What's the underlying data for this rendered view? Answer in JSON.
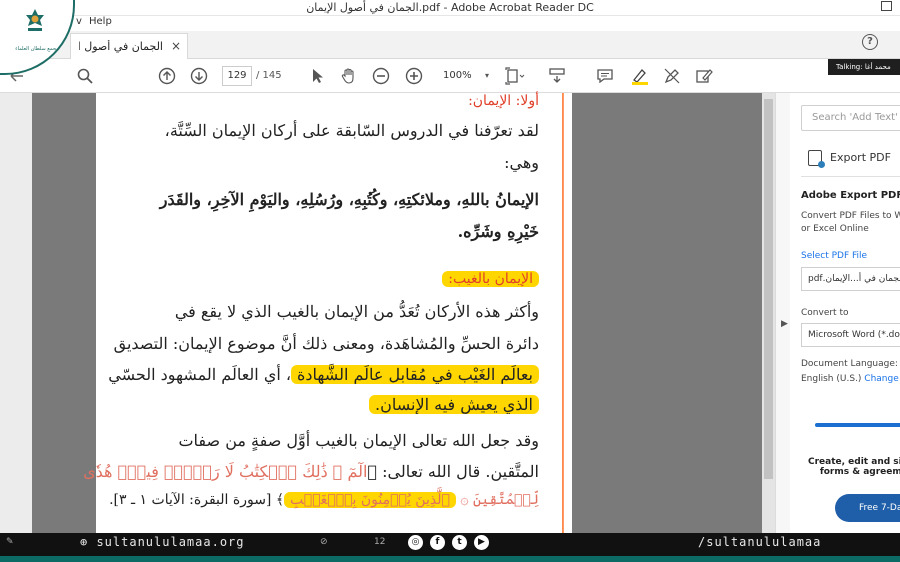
{
  "window": {
    "title": "الجمان في أصول الإيمان.pdf - Adobe Acrobat Reader DC",
    "menu": [
      "v",
      "Help"
    ]
  },
  "tab": {
    "label": "الجمان في أصول الإي",
    "close": "×"
  },
  "help_icon": "?",
  "toolbar": {
    "page_current": "129",
    "page_total": "/ 145",
    "zoom": "100%",
    "zoom_caret": "▾",
    "icons": [
      "hand-icon-left",
      "zoom-search-icon",
      "page-up-icon",
      "page-down-icon",
      "select-cursor-icon",
      "hand-tool-icon",
      "zoom-out-icon",
      "zoom-in-icon",
      "fit-page-icon",
      "scroll-mode-icon",
      "comment-icon",
      "highlight-icon",
      "draw-icon",
      "fill-sign-icon"
    ]
  },
  "talking_badge": "Talking: محمد أغا",
  "document": {
    "heading": "أولا: الإيمان:",
    "p1_line1": "لقد تعرّفنا في الدروس السّابقة على أركان الإيمان السِّتَّة،",
    "p1_line2": "وهي:",
    "p2_line1": "الإيمانُ باللهِ، وملائكتِهِ، وكُتُبِهِ، ورُسُلِهِ، واليَوْمِ الآخِرِ، والقَدَر",
    "p2_line2": "خَيْرِهِ وشَرِّه.",
    "subheading": "الإيمان بالغيب:",
    "p3_line1": "وأكثر هذه الأركان تُعَدُّ من الإيمان بالغيب الذي لا يقع في",
    "p3_line2": "دائرة الحسِّ والمُشاهَدة، ومعنى ذلك أنَّ موضوع الإيمان: التصديق",
    "p3_line3_hl": "بعالَم الغَيْب في مُقابل عالَم الشَّهادة",
    "p3_line3_rest": "، أي العالَم المشهود الحسّي",
    "p3_line4_hl": "الذي يعيش فيه الإنسان.",
    "p4_line1": "وقد جعل الله تعالى الإيمان بالغيب أوَّل صفةٍ من صفات",
    "p4_line2_text": "المتَّقين. قال الله تعالى: ﴿",
    "p4_line2_quote": "الٓمٓ ۞ ذَٰلِكَ ٱلۡكِتَٰبُ لَا رَيۡبَۛ فِيهِۛ هُدٗى",
    "p4_line3_quote": "لِّلۡمُتَّقِينَ ۞",
    "p4_line3_hl": "ٱلَّذِينَ يُؤۡمِنُونَ بِٱلۡغَيۡبِ",
    "p4_line3_rest": "﴾ [سورة البقرة: الآيات ١ ـ ٣]."
  },
  "right_panel": {
    "search_placeholder": "Search 'Add Text'",
    "export_label": "Export PDF",
    "export_heading": "Adobe Export PDF",
    "export_desc1": "Convert PDF Files to W",
    "export_desc2": "or Excel Online",
    "select_file": "Select PDF File",
    "file_name": "الجمان في أ...الإيمان.pdf",
    "convert_to": "Convert to",
    "convert_value": "Microsoft Word (*.doc",
    "doc_language": "Document Language:",
    "language_value": "English (U.S.)",
    "change_link": "Change",
    "promo1": "Create, edit and si",
    "promo2": "forms & agreem",
    "trial_button": "Free 7-Day Tri"
  },
  "footer": {
    "site_left": "⊕ sultanululamaa.org",
    "site_right": "/sultanululamaa",
    "social": [
      "◎",
      "f",
      "t",
      "▶"
    ],
    "tray": [
      "⊘",
      "12"
    ]
  },
  "logo": {
    "name": "مجمع سلطان العلماء"
  },
  "colors": {
    "highlight": "#ffd600",
    "heading_red": "#e0402a",
    "brand_teal": "#0d6b66",
    "trial_blue": "#1f5ea8"
  }
}
